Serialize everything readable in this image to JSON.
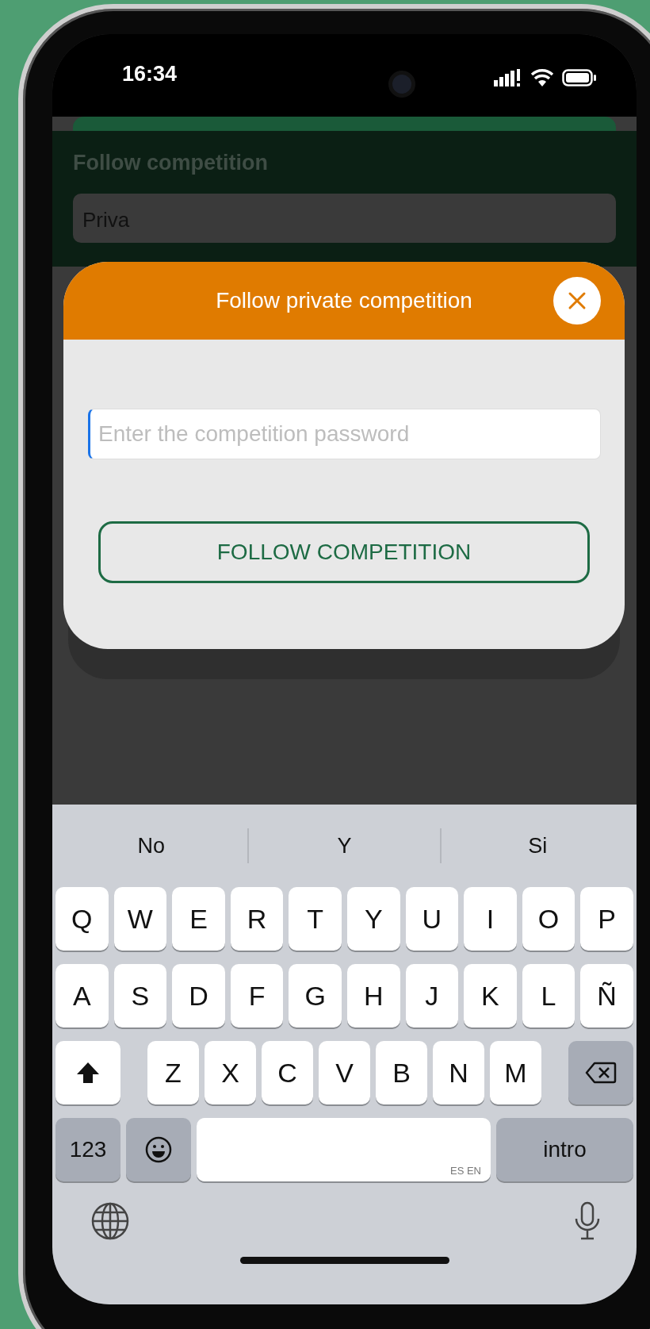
{
  "status_bar": {
    "time": "16:34"
  },
  "background_form": {
    "label": "Follow competition",
    "value": "Priva"
  },
  "dialog": {
    "title": "Follow private competition",
    "password_field": {
      "placeholder": "Enter the competition password"
    },
    "button": "FOLLOW COMPETITION"
  },
  "keyboard": {
    "suggestions": [
      "No",
      "Y",
      "Si"
    ],
    "rows": [
      [
        "Q",
        "W",
        "E",
        "R",
        "T",
        "Y",
        "U",
        "I",
        "O",
        "P"
      ],
      [
        "A",
        "S",
        "D",
        "F",
        "G",
        "H",
        "J",
        "K",
        "L",
        "Ñ"
      ],
      [
        "Z",
        "X",
        "C",
        "V",
        "B",
        "N",
        "M"
      ]
    ],
    "numbers_key": "123",
    "space_hint": "ES EN",
    "return_key": "intro"
  }
}
